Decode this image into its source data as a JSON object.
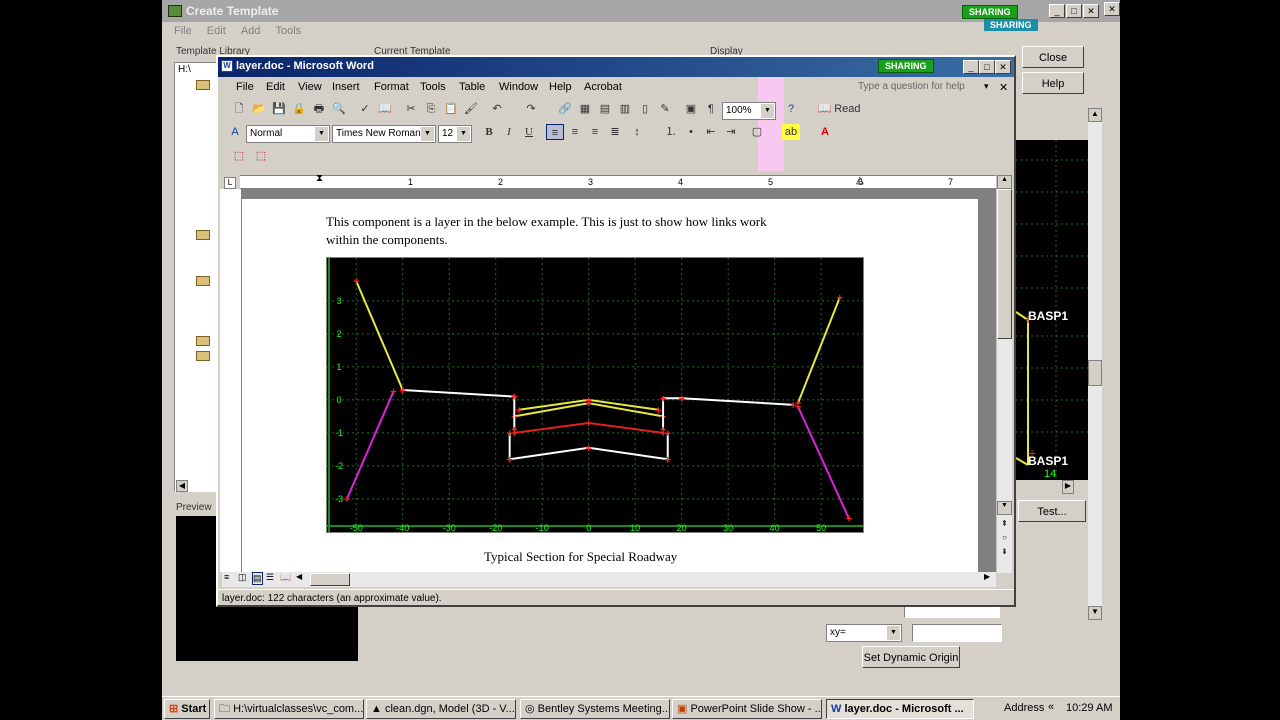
{
  "back_window": {
    "title": "Create Template",
    "menu": [
      "File",
      "Edit",
      "Add",
      "Tools"
    ],
    "section_library": "Template Library",
    "section_current": "Current Template",
    "section_display": "Display",
    "path": "H:\\",
    "preview_label": "Preview",
    "buttons": {
      "close": "Close",
      "help": "Help",
      "test": "Test...",
      "dynamic_origin": "Set Dynamic Origin"
    },
    "xy_select": "xy=",
    "right_labels": [
      "BASP1",
      "BASP1",
      "14"
    ]
  },
  "sharing": {
    "label": "SHARING"
  },
  "word": {
    "title": "layer.doc - Microsoft Word",
    "menu": [
      "File",
      "Edit",
      "View",
      "Insert",
      "Format",
      "Tools",
      "Table",
      "Window",
      "Help",
      "Acrobat"
    ],
    "help_placeholder": "Type a question for help",
    "zoom": "100%",
    "read_label": "Read",
    "style": "Normal",
    "font": "Times New Roman",
    "size": "12",
    "ruler_numbers": [
      "1",
      "2",
      "3",
      "4",
      "5",
      "6",
      "7"
    ],
    "body_line1": "This component is a layer in the below example.  This is just to show how links work",
    "body_line2": "within the components.",
    "caption": "Typical Section for Special Roadway",
    "status": "layer.doc: 122 characters (an approximate value)."
  },
  "chart_data": {
    "type": "line",
    "title": "",
    "xlabel": "",
    "ylabel": "",
    "x_ticks": [
      -50,
      -40,
      -30,
      -20,
      -10,
      0,
      10,
      20,
      30,
      40,
      50
    ],
    "y_ticks": [
      3,
      2,
      1,
      0,
      -1,
      -2,
      -3
    ],
    "xlim": [
      -55,
      59
    ],
    "ylim": [
      -3.7,
      4.3
    ],
    "grid": true,
    "background": "#000000",
    "series": [
      {
        "color": "#e8e840",
        "points": [
          [
            -50,
            3.6
          ],
          [
            -40,
            0.3
          ]
        ]
      },
      {
        "color": "#e8e840",
        "points": [
          [
            54,
            3.1
          ],
          [
            45,
            -0.1
          ]
        ]
      },
      {
        "color": "#e020e0",
        "points": [
          [
            -52,
            -3.0
          ],
          [
            -42,
            0.25
          ]
        ]
      },
      {
        "color": "#e020e0",
        "points": [
          [
            45,
            -0.2
          ],
          [
            56,
            -3.6
          ]
        ]
      },
      {
        "color": "#ffffff",
        "points": [
          [
            -40,
            0.3
          ],
          [
            -16,
            0.1
          ]
        ]
      },
      {
        "color": "#ffffff",
        "points": [
          [
            20,
            0.05
          ],
          [
            44,
            -0.15
          ]
        ]
      },
      {
        "color": "#e8e840",
        "points": [
          [
            -15,
            -0.3
          ],
          [
            0,
            0
          ],
          [
            15,
            -0.3
          ]
        ]
      },
      {
        "color": "#e8e840",
        "points": [
          [
            -16,
            -0.5
          ],
          [
            0,
            -0.1
          ],
          [
            16,
            -0.5
          ]
        ]
      },
      {
        "color": "#e02020",
        "points": [
          [
            -16,
            -1.0
          ],
          [
            0,
            -0.7
          ],
          [
            16,
            -1.0
          ]
        ]
      },
      {
        "color": "#ffffff",
        "points": [
          [
            -17,
            -1.8
          ],
          [
            0,
            -1.45
          ],
          [
            17,
            -1.8
          ]
        ]
      },
      {
        "color": "#ffffff",
        "points": [
          [
            -17,
            -1.0
          ],
          [
            -17,
            -1.8
          ]
        ]
      },
      {
        "color": "#ffffff",
        "points": [
          [
            17,
            -1.0
          ],
          [
            17,
            -1.8
          ]
        ]
      },
      {
        "color": "#ffffff",
        "points": [
          [
            -16,
            0.1
          ],
          [
            -16,
            -0.9
          ]
        ]
      },
      {
        "color": "#ffffff",
        "points": [
          [
            16,
            0.05
          ],
          [
            16,
            -0.9
          ]
        ]
      },
      {
        "color": "#ffffff",
        "points": [
          [
            16,
            0.05
          ],
          [
            20,
            0.05
          ]
        ]
      }
    ]
  },
  "taskbar": {
    "start": "Start",
    "tasks": [
      "H:\\virtualclasses\\vc_com...",
      "clean.dgn, Model (3D - V...",
      "Bentley Systems Meeting...",
      "PowerPoint Slide Show - ...",
      "layer.doc - Microsoft ..."
    ],
    "address": "Address",
    "time": "10:29 AM"
  }
}
